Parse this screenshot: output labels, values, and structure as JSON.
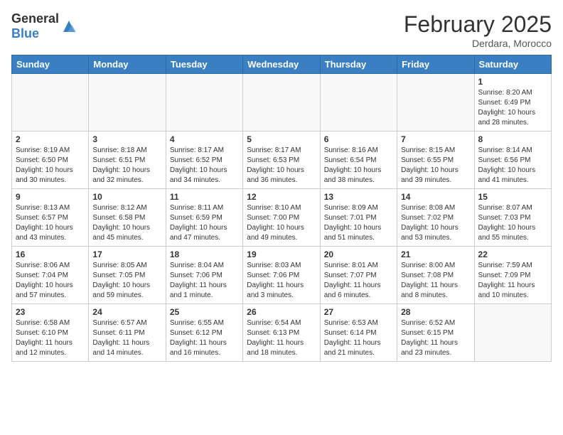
{
  "header": {
    "logo_general": "General",
    "logo_blue": "Blue",
    "month": "February 2025",
    "location": "Derdara, Morocco"
  },
  "days_of_week": [
    "Sunday",
    "Monday",
    "Tuesday",
    "Wednesday",
    "Thursday",
    "Friday",
    "Saturday"
  ],
  "weeks": [
    [
      {
        "day": "",
        "info": ""
      },
      {
        "day": "",
        "info": ""
      },
      {
        "day": "",
        "info": ""
      },
      {
        "day": "",
        "info": ""
      },
      {
        "day": "",
        "info": ""
      },
      {
        "day": "",
        "info": ""
      },
      {
        "day": "1",
        "info": "Sunrise: 8:20 AM\nSunset: 6:49 PM\nDaylight: 10 hours and 28 minutes."
      }
    ],
    [
      {
        "day": "2",
        "info": "Sunrise: 8:19 AM\nSunset: 6:50 PM\nDaylight: 10 hours and 30 minutes."
      },
      {
        "day": "3",
        "info": "Sunrise: 8:18 AM\nSunset: 6:51 PM\nDaylight: 10 hours and 32 minutes."
      },
      {
        "day": "4",
        "info": "Sunrise: 8:17 AM\nSunset: 6:52 PM\nDaylight: 10 hours and 34 minutes."
      },
      {
        "day": "5",
        "info": "Sunrise: 8:17 AM\nSunset: 6:53 PM\nDaylight: 10 hours and 36 minutes."
      },
      {
        "day": "6",
        "info": "Sunrise: 8:16 AM\nSunset: 6:54 PM\nDaylight: 10 hours and 38 minutes."
      },
      {
        "day": "7",
        "info": "Sunrise: 8:15 AM\nSunset: 6:55 PM\nDaylight: 10 hours and 39 minutes."
      },
      {
        "day": "8",
        "info": "Sunrise: 8:14 AM\nSunset: 6:56 PM\nDaylight: 10 hours and 41 minutes."
      }
    ],
    [
      {
        "day": "9",
        "info": "Sunrise: 8:13 AM\nSunset: 6:57 PM\nDaylight: 10 hours and 43 minutes."
      },
      {
        "day": "10",
        "info": "Sunrise: 8:12 AM\nSunset: 6:58 PM\nDaylight: 10 hours and 45 minutes."
      },
      {
        "day": "11",
        "info": "Sunrise: 8:11 AM\nSunset: 6:59 PM\nDaylight: 10 hours and 47 minutes."
      },
      {
        "day": "12",
        "info": "Sunrise: 8:10 AM\nSunset: 7:00 PM\nDaylight: 10 hours and 49 minutes."
      },
      {
        "day": "13",
        "info": "Sunrise: 8:09 AM\nSunset: 7:01 PM\nDaylight: 10 hours and 51 minutes."
      },
      {
        "day": "14",
        "info": "Sunrise: 8:08 AM\nSunset: 7:02 PM\nDaylight: 10 hours and 53 minutes."
      },
      {
        "day": "15",
        "info": "Sunrise: 8:07 AM\nSunset: 7:03 PM\nDaylight: 10 hours and 55 minutes."
      }
    ],
    [
      {
        "day": "16",
        "info": "Sunrise: 8:06 AM\nSunset: 7:04 PM\nDaylight: 10 hours and 57 minutes."
      },
      {
        "day": "17",
        "info": "Sunrise: 8:05 AM\nSunset: 7:05 PM\nDaylight: 10 hours and 59 minutes."
      },
      {
        "day": "18",
        "info": "Sunrise: 8:04 AM\nSunset: 7:06 PM\nDaylight: 11 hours and 1 minute."
      },
      {
        "day": "19",
        "info": "Sunrise: 8:03 AM\nSunset: 7:06 PM\nDaylight: 11 hours and 3 minutes."
      },
      {
        "day": "20",
        "info": "Sunrise: 8:01 AM\nSunset: 7:07 PM\nDaylight: 11 hours and 6 minutes."
      },
      {
        "day": "21",
        "info": "Sunrise: 8:00 AM\nSunset: 7:08 PM\nDaylight: 11 hours and 8 minutes."
      },
      {
        "day": "22",
        "info": "Sunrise: 7:59 AM\nSunset: 7:09 PM\nDaylight: 11 hours and 10 minutes."
      }
    ],
    [
      {
        "day": "23",
        "info": "Sunrise: 6:58 AM\nSunset: 6:10 PM\nDaylight: 11 hours and 12 minutes."
      },
      {
        "day": "24",
        "info": "Sunrise: 6:57 AM\nSunset: 6:11 PM\nDaylight: 11 hours and 14 minutes."
      },
      {
        "day": "25",
        "info": "Sunrise: 6:55 AM\nSunset: 6:12 PM\nDaylight: 11 hours and 16 minutes."
      },
      {
        "day": "26",
        "info": "Sunrise: 6:54 AM\nSunset: 6:13 PM\nDaylight: 11 hours and 18 minutes."
      },
      {
        "day": "27",
        "info": "Sunrise: 6:53 AM\nSunset: 6:14 PM\nDaylight: 11 hours and 21 minutes."
      },
      {
        "day": "28",
        "info": "Sunrise: 6:52 AM\nSunset: 6:15 PM\nDaylight: 11 hours and 23 minutes."
      },
      {
        "day": "",
        "info": ""
      }
    ]
  ]
}
